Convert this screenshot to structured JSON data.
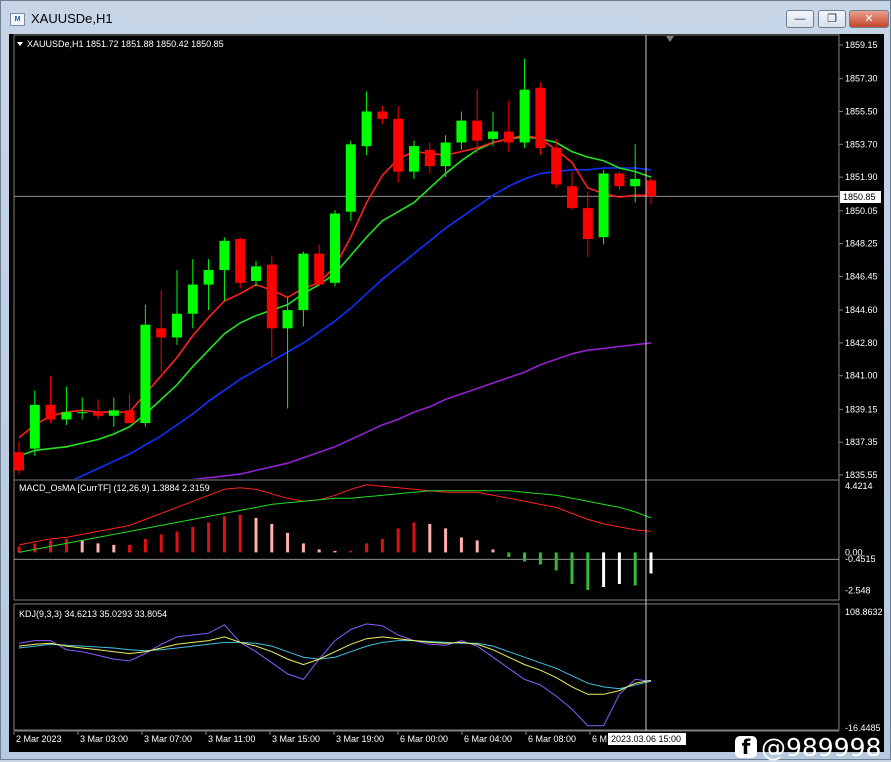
{
  "window": {
    "title": "XAUUSDe,H1",
    "icon_glyph": "M",
    "minimize_glyph": "—",
    "restore_glyph": "❐",
    "close_glyph": "✕"
  },
  "main_panel": {
    "header": "XAUUSDe,H1  1851.72 1851.88 1850.42 1850.85",
    "current_price_label": "1850.85",
    "price_ticks": [
      "1859.15",
      "1857.30",
      "1855.50",
      "1853.70",
      "1851.90",
      "1850.05",
      "1848.25",
      "1846.45",
      "1844.60",
      "1842.80",
      "1841.00",
      "1839.15",
      "1837.35",
      "1835.55"
    ]
  },
  "macd_panel": {
    "header": "MACD_OsMA [CurrTF] (12,26,9) 1.3884 2.3159",
    "ticks": [
      "4.4214",
      "0.00",
      "-0.4515",
      "-2.548"
    ]
  },
  "kdj_panel": {
    "header": "KDJ(9,3,3) 34.6213 35.0293 33.8054",
    "ticks": [
      "108.8632",
      "-16.4485"
    ]
  },
  "time_axis": {
    "labels": [
      "2 Mar 2023",
      "3 Mar 03:00",
      "3 Mar 07:00",
      "3 Mar 11:00",
      "3 Mar 15:00",
      "3 Mar 19:00",
      "6 Mar 00:00",
      "6 Mar 04:00",
      "6 Mar 08:00",
      "6 M"
    ],
    "crosshair_label": "2023.03.06 15:00"
  },
  "watermark": {
    "icon": "f",
    "text": "@989998"
  },
  "colors": {
    "bull": "#00ff00",
    "bear": "#ff0000",
    "ma_fast": "#ff2020",
    "ma_mid": "#22e022",
    "ma_slow": "#1030ff",
    "ma_long": "#9020d0",
    "macd_hist_pos": "#dd1111",
    "macd_hist_pos_dn": "#ffb0b0",
    "macd_hist_neg": "#33bb33",
    "macd_hist_neg_up": "#ffffff"
  },
  "chart_data": {
    "type": "candlestick",
    "candles": [
      {
        "o": 1836.8,
        "h": 1837.4,
        "l": 1835.6,
        "c": 1835.8
      },
      {
        "o": 1837.0,
        "h": 1840.2,
        "l": 1836.6,
        "c": 1839.4
      },
      {
        "o": 1839.4,
        "h": 1841.0,
        "l": 1838.4,
        "c": 1838.6
      },
      {
        "o": 1838.6,
        "h": 1840.4,
        "l": 1838.3,
        "c": 1839.0
      },
      {
        "o": 1839.0,
        "h": 1839.8,
        "l": 1838.6,
        "c": 1839.0
      },
      {
        "o": 1839.0,
        "h": 1839.7,
        "l": 1838.6,
        "c": 1838.8
      },
      {
        "o": 1838.8,
        "h": 1839.8,
        "l": 1838.2,
        "c": 1839.1
      },
      {
        "o": 1839.1,
        "h": 1840.0,
        "l": 1838.6,
        "c": 1838.4
      },
      {
        "o": 1838.4,
        "h": 1844.9,
        "l": 1838.2,
        "c": 1843.8
      },
      {
        "o": 1843.6,
        "h": 1845.7,
        "l": 1841.2,
        "c": 1843.1
      },
      {
        "o": 1843.1,
        "h": 1846.8,
        "l": 1842.7,
        "c": 1844.4
      },
      {
        "o": 1844.4,
        "h": 1847.4,
        "l": 1843.6,
        "c": 1846.0
      },
      {
        "o": 1846.0,
        "h": 1847.4,
        "l": 1844.6,
        "c": 1846.8
      },
      {
        "o": 1846.8,
        "h": 1848.6,
        "l": 1845.1,
        "c": 1848.4
      },
      {
        "o": 1848.5,
        "h": 1848.6,
        "l": 1845.8,
        "c": 1846.1
      },
      {
        "o": 1846.2,
        "h": 1847.3,
        "l": 1845.9,
        "c": 1847.0
      },
      {
        "o": 1847.1,
        "h": 1847.6,
        "l": 1842.0,
        "c": 1843.6
      },
      {
        "o": 1843.6,
        "h": 1845.3,
        "l": 1839.2,
        "c": 1844.6
      },
      {
        "o": 1844.6,
        "h": 1847.8,
        "l": 1843.7,
        "c": 1847.7
      },
      {
        "o": 1847.7,
        "h": 1848.2,
        "l": 1845.9,
        "c": 1846.0
      },
      {
        "o": 1846.1,
        "h": 1850.1,
        "l": 1845.9,
        "c": 1849.9
      },
      {
        "o": 1850.0,
        "h": 1853.9,
        "l": 1849.5,
        "c": 1853.7
      },
      {
        "o": 1853.6,
        "h": 1856.6,
        "l": 1853.1,
        "c": 1855.5
      },
      {
        "o": 1855.5,
        "h": 1855.8,
        "l": 1854.8,
        "c": 1855.1
      },
      {
        "o": 1855.1,
        "h": 1855.8,
        "l": 1851.6,
        "c": 1852.2
      },
      {
        "o": 1852.2,
        "h": 1853.9,
        "l": 1851.8,
        "c": 1853.6
      },
      {
        "o": 1853.4,
        "h": 1853.8,
        "l": 1852.1,
        "c": 1852.5
      },
      {
        "o": 1852.5,
        "h": 1854.2,
        "l": 1851.9,
        "c": 1853.8
      },
      {
        "o": 1853.8,
        "h": 1855.5,
        "l": 1853.4,
        "c": 1855.0
      },
      {
        "o": 1855.0,
        "h": 1856.7,
        "l": 1853.2,
        "c": 1853.9
      },
      {
        "o": 1854.0,
        "h": 1855.5,
        "l": 1853.6,
        "c": 1854.4
      },
      {
        "o": 1854.4,
        "h": 1856.1,
        "l": 1853.3,
        "c": 1853.8
      },
      {
        "o": 1853.8,
        "h": 1858.4,
        "l": 1853.5,
        "c": 1856.7
      },
      {
        "o": 1856.8,
        "h": 1857.1,
        "l": 1853.1,
        "c": 1853.5
      },
      {
        "o": 1853.5,
        "h": 1854.0,
        "l": 1851.3,
        "c": 1851.5
      },
      {
        "o": 1851.4,
        "h": 1852.2,
        "l": 1850.1,
        "c": 1850.2
      },
      {
        "o": 1850.2,
        "h": 1851.1,
        "l": 1847.5,
        "c": 1848.5
      },
      {
        "o": 1848.6,
        "h": 1852.3,
        "l": 1848.2,
        "c": 1852.1
      },
      {
        "o": 1852.1,
        "h": 1852.2,
        "l": 1851.2,
        "c": 1851.4
      },
      {
        "o": 1851.4,
        "h": 1853.7,
        "l": 1850.5,
        "c": 1851.8
      },
      {
        "o": 1851.72,
        "h": 1851.88,
        "l": 1850.42,
        "c": 1850.85
      }
    ],
    "ma_fast": [
      1837.6,
      1838.3,
      1838.8,
      1839.0,
      1839.1,
      1839.0,
      1839.0,
      1839.0,
      1840.0,
      1841.0,
      1842.0,
      1843.2,
      1844.2,
      1845.1,
      1845.5,
      1846.0,
      1845.7,
      1845.3,
      1845.8,
      1846.1,
      1847.0,
      1848.6,
      1850.5,
      1852.0,
      1852.9,
      1853.3,
      1853.2,
      1853.1,
      1853.3,
      1853.5,
      1853.8,
      1854.0,
      1854.2,
      1854.0,
      1853.4,
      1852.7,
      1851.3,
      1851.0,
      1850.8,
      1850.9,
      1850.9
    ],
    "ma_mid": [
      1836.6,
      1836.9,
      1837.0,
      1837.1,
      1837.3,
      1837.5,
      1837.8,
      1838.2,
      1838.9,
      1839.7,
      1840.5,
      1841.5,
      1842.4,
      1843.3,
      1843.9,
      1844.3,
      1844.6,
      1844.9,
      1845.5,
      1846.0,
      1846.6,
      1847.6,
      1848.6,
      1849.5,
      1850.0,
      1850.5,
      1851.3,
      1852.1,
      1852.8,
      1853.4,
      1853.8,
      1854.0,
      1854.1,
      1854.0,
      1853.8,
      1853.3,
      1853.0,
      1852.8,
      1852.4,
      1852.2,
      1851.9
    ],
    "ma_slow": [
      1833.9,
      1834.3,
      1834.7,
      1835.1,
      1835.5,
      1835.9,
      1836.3,
      1836.7,
      1837.2,
      1837.7,
      1838.3,
      1838.9,
      1839.6,
      1840.2,
      1840.8,
      1841.3,
      1841.8,
      1842.3,
      1842.8,
      1843.4,
      1844.0,
      1844.7,
      1845.5,
      1846.3,
      1847.0,
      1847.7,
      1848.4,
      1849.1,
      1849.7,
      1850.3,
      1850.9,
      1851.4,
      1851.8,
      1852.1,
      1852.2,
      1852.3,
      1852.3,
      1852.4,
      1852.4,
      1852.4,
      1852.3
    ],
    "ma_long": [
      1834.2,
      1834.3,
      1834.4,
      1834.5,
      1834.6,
      1834.7,
      1834.8,
      1834.9,
      1835.0,
      1835.1,
      1835.2,
      1835.3,
      1835.4,
      1835.5,
      1835.6,
      1835.8,
      1836.0,
      1836.2,
      1836.5,
      1836.8,
      1837.1,
      1837.5,
      1837.9,
      1838.3,
      1838.6,
      1839.0,
      1839.3,
      1839.7,
      1840.0,
      1840.3,
      1840.6,
      1840.9,
      1841.2,
      1841.6,
      1841.9,
      1842.2,
      1842.4,
      1842.5,
      1842.6,
      1842.7,
      1842.8
    ],
    "macd_hist": [
      0.4,
      0.6,
      0.8,
      0.9,
      0.8,
      0.6,
      0.5,
      0.5,
      0.9,
      1.2,
      1.4,
      1.7,
      2.0,
      2.4,
      2.5,
      2.3,
      1.9,
      1.3,
      0.6,
      0.2,
      0.1,
      0.1,
      0.6,
      0.9,
      1.6,
      2.0,
      1.9,
      1.6,
      1.0,
      0.8,
      0.2,
      -0.3,
      -0.6,
      -0.8,
      -1.2,
      -2.1,
      -2.5,
      -2.3,
      -2.1,
      -2.2,
      -1.4
    ],
    "macd_line": [
      0.5,
      0.7,
      0.9,
      1.0,
      1.2,
      1.4,
      1.6,
      1.8,
      2.2,
      2.6,
      3.0,
      3.4,
      3.8,
      4.2,
      4.3,
      4.2,
      3.9,
      3.6,
      3.4,
      3.5,
      3.8,
      4.2,
      4.5,
      4.4,
      4.3,
      4.2,
      4.1,
      4.0,
      4.0,
      4.0,
      3.8,
      3.6,
      3.4,
      3.2,
      3.0,
      2.6,
      2.2,
      1.9,
      1.7,
      1.5,
      1.4
    ],
    "signal_line": [
      0.0,
      0.2,
      0.4,
      0.6,
      0.8,
      1.0,
      1.2,
      1.4,
      1.6,
      1.8,
      2.0,
      2.2,
      2.4,
      2.6,
      2.8,
      3.0,
      3.2,
      3.3,
      3.4,
      3.5,
      3.6,
      3.6,
      3.7,
      3.8,
      3.9,
      4.0,
      4.1,
      4.1,
      4.1,
      4.1,
      4.1,
      4.1,
      4.0,
      3.9,
      3.8,
      3.6,
      3.4,
      3.2,
      3.0,
      2.7,
      2.3
    ],
    "kdj_k": [
      72,
      74,
      75,
      72,
      70,
      68,
      66,
      64,
      66,
      70,
      74,
      76,
      78,
      82,
      76,
      72,
      66,
      58,
      52,
      58,
      66,
      74,
      80,
      82,
      80,
      78,
      76,
      75,
      76,
      74,
      68,
      60,
      52,
      46,
      38,
      28,
      20,
      20,
      24,
      32,
      35
    ],
    "kdj_d": [
      70,
      72,
      74,
      73,
      72,
      71,
      70,
      68,
      67,
      68,
      70,
      72,
      74,
      76,
      76,
      75,
      72,
      66,
      60,
      58,
      60,
      66,
      72,
      76,
      78,
      78,
      77,
      76,
      75,
      75,
      72,
      66,
      60,
      54,
      48,
      40,
      32,
      28,
      26,
      30,
      34
    ],
    "kdj_j": [
      75,
      78,
      78,
      68,
      66,
      62,
      58,
      56,
      64,
      74,
      82,
      84,
      86,
      95,
      76,
      66,
      54,
      42,
      36,
      58,
      78,
      90,
      96,
      94,
      84,
      78,
      74,
      73,
      78,
      72,
      60,
      48,
      36,
      30,
      18,
      4,
      -14,
      -14,
      20,
      36,
      34
    ]
  }
}
